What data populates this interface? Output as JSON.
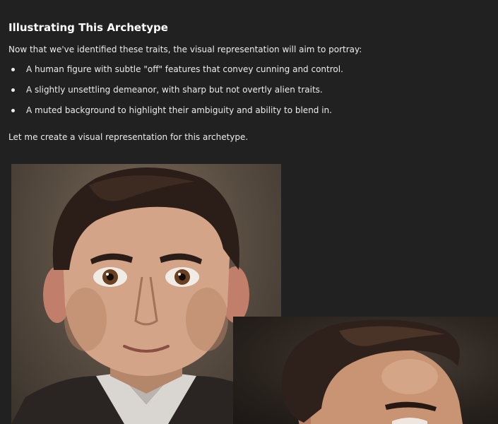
{
  "message": {
    "heading": "Illustrating This Archetype",
    "intro": "Now that we've identified these traits, the visual representation will aim to portray:",
    "bullets": [
      {
        "text": "A human figure with subtle \"off\" features that convey cunning and control."
      },
      {
        "text": "A slightly unsettling demeanor, with sharp but not overtly alien traits."
      },
      {
        "text": "A muted background to highlight their ambiguity and ability to blend in."
      }
    ],
    "outro": "Let me create a visual representation for this archetype."
  },
  "images": [
    {
      "kind": "generated-portrait",
      "subject": "front-facing man with dark slicked hair and large brown eyes"
    },
    {
      "kind": "generated-portrait",
      "subject": "three-quarter view man with dark swept hair"
    }
  ],
  "colors": {
    "background": "#212121",
    "text": "#ececec",
    "heading": "#ffffff"
  }
}
